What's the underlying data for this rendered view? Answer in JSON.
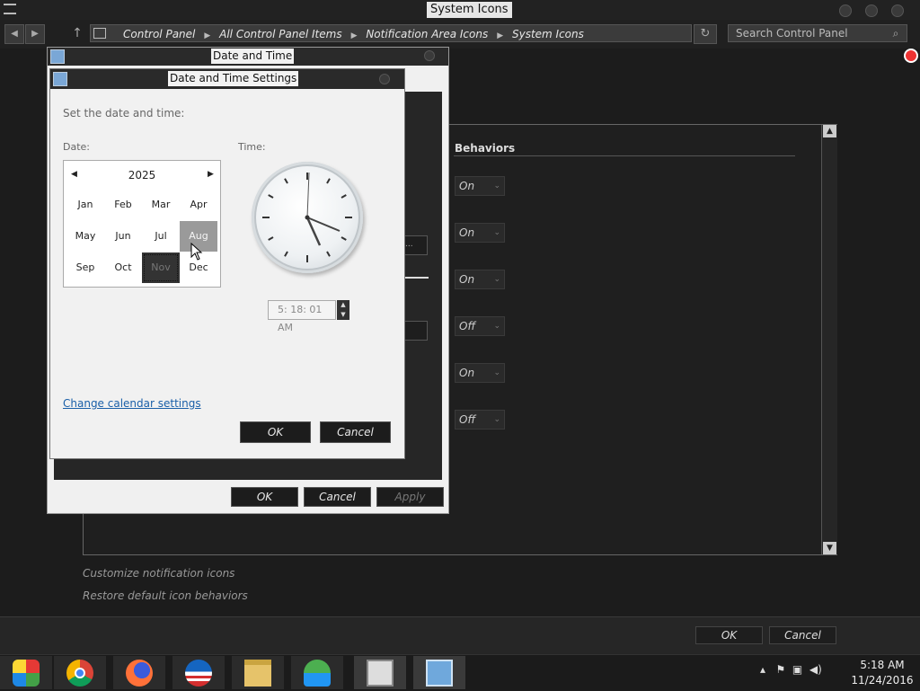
{
  "window": {
    "title": "System Icons"
  },
  "address": {
    "crumbs": [
      "Control Panel",
      "All Control Panel Items",
      "Notification Area Icons",
      "System Icons"
    ],
    "search_placeholder": "Search Control Panel"
  },
  "content": {
    "behaviors_header": "Behaviors",
    "behaviors": [
      "On",
      "On",
      "On",
      "Off",
      "On",
      "Off"
    ],
    "links": [
      "Customize notification icons",
      "Restore default icon behaviors"
    ],
    "ok": "OK",
    "cancel": "Cancel"
  },
  "dt_dialog": {
    "title": "Date and Time",
    "ok": "OK",
    "cancel": "Cancel",
    "apply": "Apply"
  },
  "dts_dialog": {
    "title": "Date and Time Settings",
    "instruction": "Set the date and time:",
    "date_label": "Date:",
    "time_label": "Time:",
    "year": "2025",
    "months": [
      "Jan",
      "Feb",
      "Mar",
      "Apr",
      "May",
      "Jun",
      "Jul",
      "Aug",
      "Sep",
      "Oct",
      "Nov",
      "Dec"
    ],
    "hovered_month": "Aug",
    "selected_month": "Nov",
    "time_value": "5: 18: 01 AM",
    "change_calendar": "Change calendar settings",
    "ok": "OK",
    "cancel": "Cancel"
  },
  "taskbar": {
    "apps": [
      "windows-media-center-icon",
      "chrome-icon",
      "firefox-icon",
      "obama-logo-icon",
      "file-explorer-icon",
      "network-people-icon",
      "control-panel-icon",
      "date-time-icon"
    ],
    "time": "5:18 AM",
    "date": "11/24/2016"
  }
}
